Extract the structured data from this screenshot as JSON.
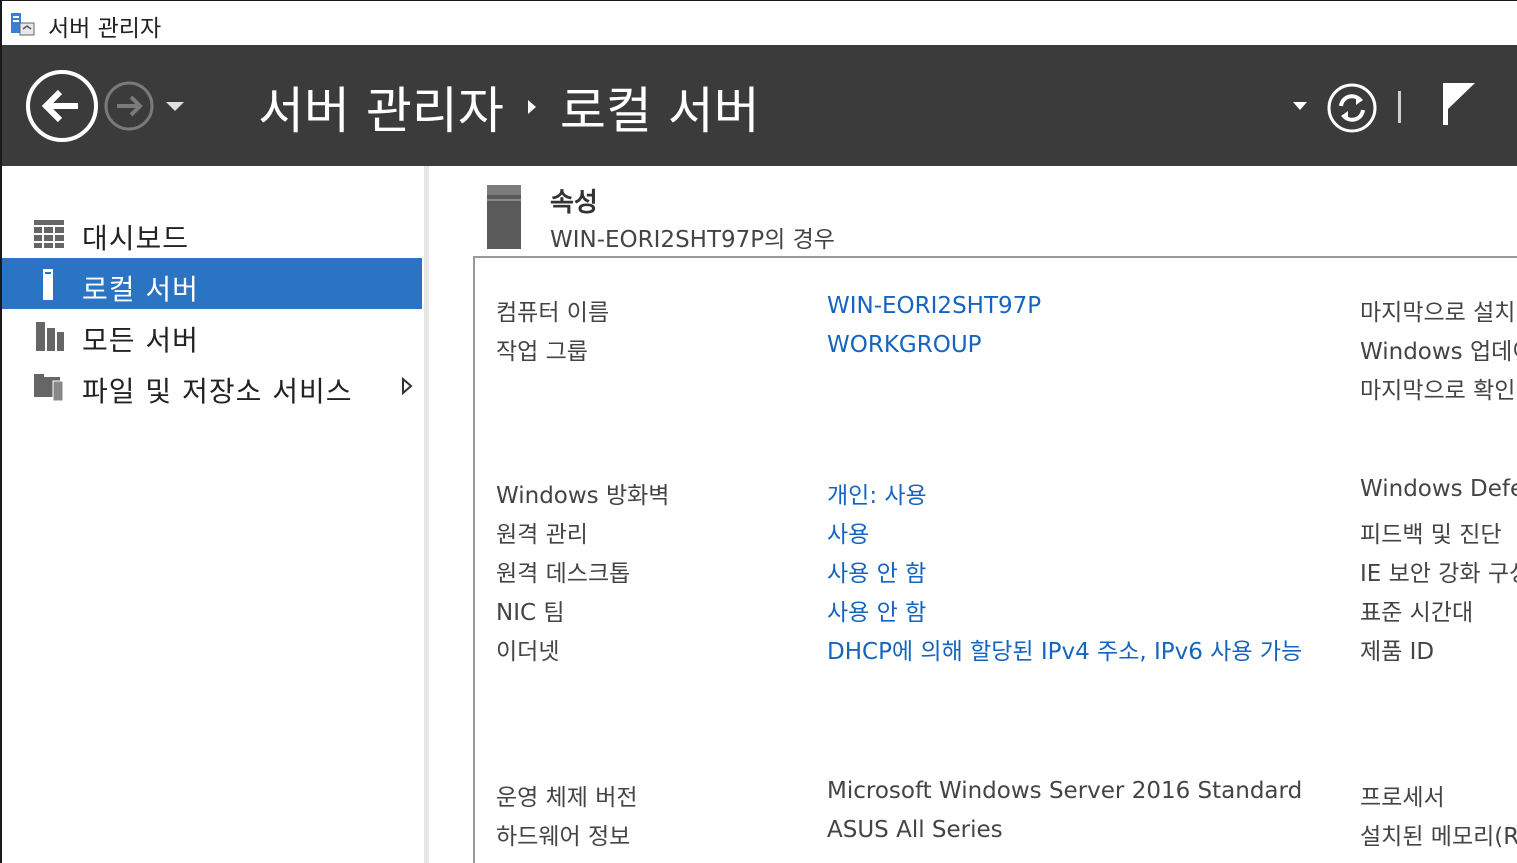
{
  "window": {
    "title": "서버 관리자"
  },
  "header": {
    "crumb_root": "서버 관리자",
    "crumb_current": "로컬 서버"
  },
  "sidebar": {
    "items": [
      {
        "label": "대시보드",
        "icon": "dashboard-icon",
        "selected": false
      },
      {
        "label": "로컬 서버",
        "icon": "local-server-icon",
        "selected": true
      },
      {
        "label": "모든 서버",
        "icon": "all-servers-icon",
        "selected": false
      },
      {
        "label": "파일 및 저장소 서비스",
        "icon": "file-storage-icon",
        "selected": false,
        "has_submenu": true
      }
    ]
  },
  "properties": {
    "title": "속성",
    "subtitle": "WIN-EORI2SHT97P의 경우",
    "rows": [
      {
        "label": "컴퓨터 이름",
        "value": "WIN-EORI2SHT97P",
        "link": true,
        "right_label": "마지막으로 설치"
      },
      {
        "label": "작업 그룹",
        "value": "WORKGROUP",
        "link": true,
        "right_label": "Windows 업데이트"
      },
      {
        "label": "",
        "value": "",
        "link": false,
        "right_label": "마지막으로 확인"
      },
      {
        "label": "Windows 방화벽",
        "value": "개인: 사용",
        "link": true,
        "right_label": "Windows Defender"
      },
      {
        "label": "원격 관리",
        "value": "사용",
        "link": true,
        "right_label": "피드백 및 진단"
      },
      {
        "label": "원격 데스크톱",
        "value": "사용 안 함",
        "link": true,
        "right_label": "IE 보안 강화 구성"
      },
      {
        "label": "NIC 팀",
        "value": "사용 안 함",
        "link": true,
        "right_label": "표준 시간대"
      },
      {
        "label": "이더넷",
        "value": "DHCP에 의해 할당된 IPv4 주소, IPv6 사용 가능",
        "link": true,
        "right_label": "제품 ID"
      },
      {
        "label": "운영 체제 버전",
        "value": "Microsoft Windows Server 2016 Standard",
        "link": false,
        "right_label": "프로세서"
      },
      {
        "label": "하드웨어 정보",
        "value": "ASUS All Series",
        "link": false,
        "right_label": "설치된 메모리(RAM)"
      }
    ]
  },
  "colors": {
    "header_bg": "#3b3b3b",
    "selected_bg": "#2b74c4",
    "link": "#1565c0"
  }
}
